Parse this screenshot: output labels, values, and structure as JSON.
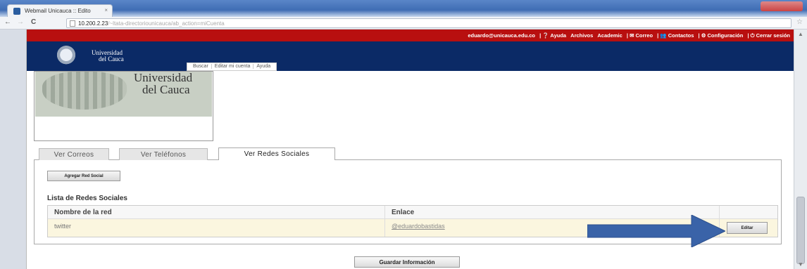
{
  "browser": {
    "tab_title": "Webmail Unicauca :: Edito",
    "tab_close": "×",
    "back_glyph": "←",
    "forward_glyph": "→",
    "reload_glyph": "C",
    "address_host": "10.200.2.23",
    "address_rest": "/~ltata-directoriounicauca/ab_action=miCuenta",
    "star_glyph": "☆"
  },
  "topbar": {
    "email": "eduardo@unicauca.edu.co",
    "items": [
      "| ❔ Ayuda",
      "Archivos",
      "Academic",
      "| ✉ Correo",
      "| 👥 Contactos",
      "| ⚙ Configuración",
      "| ⏻ Cerrar sesión"
    ]
  },
  "brand": {
    "line1": "Universidad",
    "line2": "del Cauca"
  },
  "menu": {
    "items": [
      "Buscar",
      "Editar mi cuenta",
      "Ayuda"
    ]
  },
  "photo": {
    "line1": "Universidad",
    "line2": "del Cauca"
  },
  "tabs": [
    "Ver Correos",
    "Ver Teléfonos",
    "Ver Redes Sociales"
  ],
  "panel": {
    "add_button": "Agregar Red Social",
    "list_title": "Lista de Redes Sociales",
    "columns": [
      "Nombre de la red",
      "Enlace"
    ],
    "rows": [
      {
        "name": "twitter",
        "link": "@eduardobastidas",
        "action": "Editar"
      }
    ]
  },
  "save_button": "Guardar Información",
  "colors": {
    "topbar_red": "#b80f0f",
    "brand_navy": "#0b2a66",
    "row_highlight": "#fbf6df",
    "arrow_blue": "#3a63a8"
  }
}
